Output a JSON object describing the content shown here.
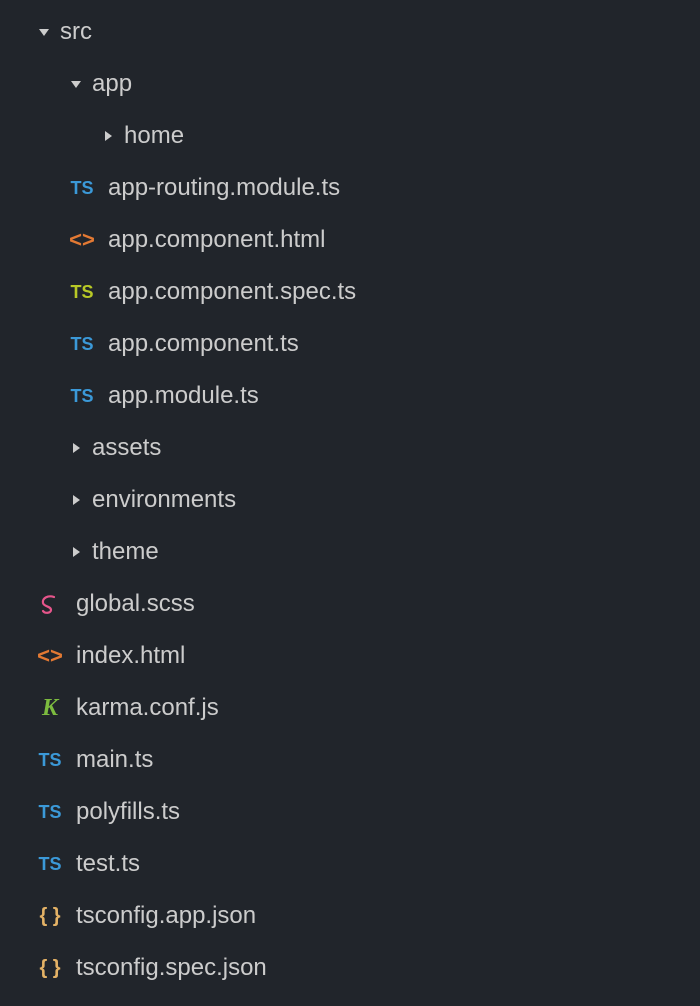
{
  "tree": {
    "src": "src",
    "app": "app",
    "home": "home",
    "app_routing": "app-routing.module.ts",
    "app_component_html": "app.component.html",
    "app_component_spec": "app.component.spec.ts",
    "app_component_ts": "app.component.ts",
    "app_module": "app.module.ts",
    "assets": "assets",
    "environments": "environments",
    "theme": "theme",
    "global_scss": "global.scss",
    "index_html": "index.html",
    "karma_conf": "karma.conf.js",
    "main_ts": "main.ts",
    "polyfills_ts": "polyfills.ts",
    "test_ts": "test.ts",
    "tsconfig_app": "tsconfig.app.json",
    "tsconfig_spec": "tsconfig.spec.json"
  },
  "icons": {
    "ts": "TS",
    "html": "<>",
    "scss": "S",
    "karma": "K",
    "json": "{ }"
  }
}
